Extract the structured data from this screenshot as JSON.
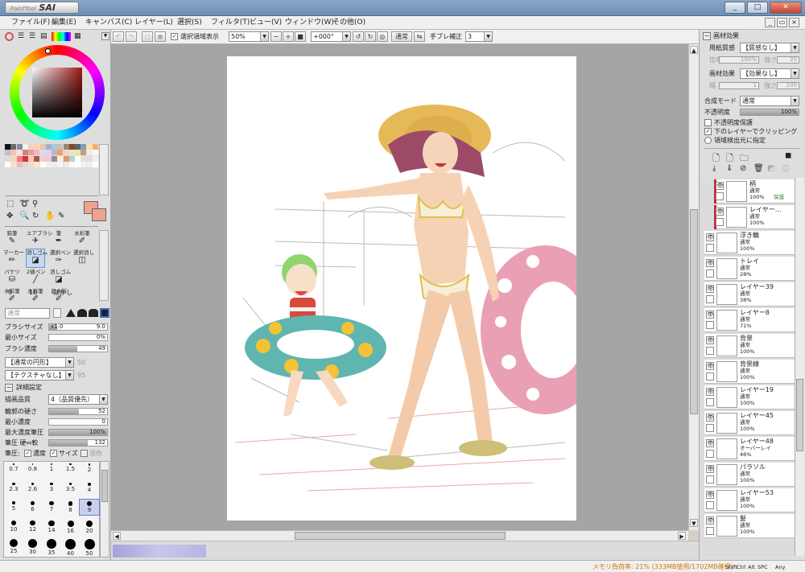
{
  "app": {
    "logo_small": "PaintTool",
    "logo_big": "SAI",
    "window_buttons": [
      "_",
      "□",
      "✕"
    ]
  },
  "menu": {
    "items": [
      "ファイル(F)",
      "編集(E)",
      "キャンバス(C)",
      "レイヤー(L)",
      "選択(S)",
      "フィルタ(T)",
      "ビュー(V)",
      "ウィンドウ(W)",
      "その他(O)"
    ]
  },
  "toolbar": {
    "selection_display_label": "選択領域表示",
    "zoom": "50%",
    "angle": "+000°",
    "mode": "通常",
    "stabilizer_label": "手ブレ補正",
    "stabilizer_value": "3"
  },
  "color": {
    "primary": "#efa38c",
    "wheel_center": "#a02020",
    "swatches": [
      "#111111",
      "#6a6a6a",
      "#7e8c9c",
      "#f2f2f2",
      "#e9d6c8",
      "#ffd0b0",
      "#ecc6a3",
      "#a0b3cc",
      "#aac8e0",
      "#c8c2b0",
      "#998877",
      "#884422",
      "#556677",
      "#80a0b0",
      "#ffe0a0",
      "#f0b070",
      "#c0c0c0",
      "#f4c4b0",
      "#ffdddd",
      "#cc8877",
      "#ee99aa",
      "#ffb0c0",
      "#d0e0f0",
      "#e0d0f0",
      "#bbbbbb",
      "#e8a070",
      "#f5d5c5",
      "#dbe9d0",
      "#f7e0a0",
      "#c0a080",
      "#eeeeee",
      "#f8f8f8",
      "#dddddd",
      "#f0d8c8",
      "#ff7777",
      "#cc3344",
      "#ffccaa",
      "#aa5544",
      "#f8c8d0",
      "#eecccc",
      "#9988aa",
      "#ffeecc",
      "#dd9966",
      "#bbccdd",
      "#ffffff",
      "#eae0d0",
      "#e0e0e0",
      "#f0f0f0",
      "#ffffff",
      "#f2e2d2",
      "#e8c0b0",
      "#d9d9d9",
      "#f9d9c9",
      "#fde6d6",
      "#ffffff",
      "#f0f0f0",
      "#ececec",
      "#f5f5f5",
      "#eaeaea",
      "#fafafa",
      "#ffffff",
      "#f3f3f3",
      "#eeeeee",
      "#ffffff"
    ]
  },
  "tools": {
    "cells": [
      {
        "name": "鉛筆",
        "icon": "✎"
      },
      {
        "name": "エアブラシ",
        "icon": "✈"
      },
      {
        "name": "筆",
        "icon": "✒"
      },
      {
        "name": "水彩筆",
        "icon": "✐"
      },
      {
        "name": "マーカー",
        "icon": "✏"
      },
      {
        "name": "消しゴム",
        "icon": "◪"
      },
      {
        "name": "選択ペン",
        "icon": "✑"
      },
      {
        "name": "選択消し",
        "icon": "◫"
      },
      {
        "name": "バケツ",
        "icon": "⛁"
      },
      {
        "name": "2値ペン",
        "icon": "╱"
      },
      {
        "name": "消しゴム",
        "icon": "◪"
      },
      {
        "name": "",
        "icon": ""
      },
      {
        "name": "水彩筆",
        "icon": "✐"
      },
      {
        "name": "水彩筆",
        "icon": "✐"
      },
      {
        "name": "旧水彩",
        "icon": "✐"
      },
      {
        "name": "",
        "icon": ""
      }
    ],
    "sub_labels": [
      "9",
      "10",
      "ぼかし"
    ],
    "blend_mode": "通常"
  },
  "brush": {
    "size_label": "ブラシサイズ",
    "size_mult": "x1.0",
    "size_value": "9.0",
    "min_size_label": "最小サイズ",
    "min_size_value": "0%",
    "density_label": "ブラシ濃度",
    "density_value": "49",
    "density_level": 0.49,
    "shape": "【通常の円形】",
    "shape_value": "50",
    "texture": "【テクスチャなし】",
    "texture_value": "95",
    "detail_label": "詳細設定",
    "quality_label": "描画品質",
    "quality_value": "4（品質優先）",
    "edge_label": "輪郭の硬さ",
    "edge_value": "52",
    "min_density_label": "最小濃度",
    "min_density_value": "0",
    "max_pressure_label": "最大濃度筆圧",
    "max_pressure_value": "100%",
    "pressure_hardness_label": "筆圧 硬⇔軟",
    "pressure_hardness_value": "132",
    "pressure_label": "筆圧:",
    "pressure_density": "濃度",
    "pressure_size": "サイズ",
    "pressure_blend": "混色",
    "sizes": [
      "0.7",
      "0.8",
      "1",
      "1.5",
      "2",
      "2.3",
      "2.6",
      "3",
      "3.5",
      "4",
      "5",
      "6",
      "7",
      "8",
      "9",
      "10",
      "12",
      "14",
      "16",
      "20",
      "25",
      "30",
      "35",
      "40",
      "50"
    ]
  },
  "right": {
    "section_title": "画材効果",
    "paper_texture_label": "用紙質感",
    "paper_texture_value": "【質感なし】",
    "scale_label": "倍率",
    "scale_value": "100%",
    "strength_label": "強さ",
    "strength_value": "20",
    "effect_label": "画材効果",
    "effect_value": "【効果なし】",
    "width_label": "幅",
    "width_value": "1",
    "effect_strength_label": "強さ",
    "effect_strength_value": "100",
    "blend_label": "合成モード",
    "blend_value": "通常",
    "opacity_label": "不透明度",
    "opacity_value": "100%",
    "protect_label": "不透明度保護",
    "clip_label": "下のレイヤーでクリッピング",
    "source_label": "領域検出元に指定"
  },
  "layers": [
    {
      "name": "柄",
      "mode": "通常",
      "opacity": "100%",
      "extra": "保護",
      "clip": true
    },
    {
      "name": "レイヤー…",
      "mode": "通常",
      "opacity": "100%",
      "extra": "",
      "clip": true
    },
    {
      "name": "浮き輪",
      "mode": "通常",
      "opacity": "100%",
      "extra": "",
      "clip": false
    },
    {
      "name": "トレイ",
      "mode": "通常",
      "opacity": "28%",
      "extra": "",
      "clip": false
    },
    {
      "name": "レイヤー39",
      "mode": "通常",
      "opacity": "38%",
      "extra": "",
      "clip": false
    },
    {
      "name": "レイヤー8",
      "mode": "通常",
      "opacity": "71%",
      "extra": "",
      "clip": false
    },
    {
      "name": "背景",
      "mode": "通常",
      "opacity": "100%",
      "extra": "",
      "clip": false
    },
    {
      "name": "背景線",
      "mode": "通常",
      "opacity": "100%",
      "extra": "",
      "clip": false
    },
    {
      "name": "レイヤー19",
      "mode": "通常",
      "opacity": "100%",
      "extra": "",
      "clip": false
    },
    {
      "name": "レイヤー45",
      "mode": "通常",
      "opacity": "100%",
      "extra": "",
      "clip": false
    },
    {
      "name": "レイヤー48",
      "mode": "オーバーレイ",
      "opacity": "46%",
      "extra": "",
      "clip": false
    },
    {
      "name": "パラソル",
      "mode": "通常",
      "opacity": "100%",
      "extra": "",
      "clip": false
    },
    {
      "name": "レイヤー53",
      "mode": "通常",
      "opacity": "100%",
      "extra": "",
      "clip": false
    },
    {
      "name": "髪",
      "mode": "通常",
      "opacity": "100%",
      "extra": "",
      "clip": false
    }
  ],
  "status": {
    "memory": "メモリ負荷率: 21% (333MB使用/1702MB確保)",
    "keys": [
      "Shift",
      "Ctrl",
      "Alt",
      "SPC",
      "Any"
    ]
  }
}
